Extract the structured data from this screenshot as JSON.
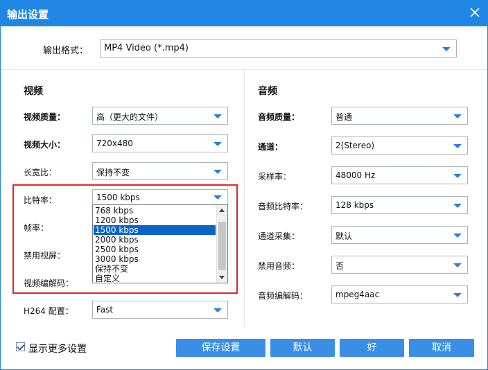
{
  "window": {
    "title": "输出设置",
    "close_icon": "close-icon"
  },
  "format": {
    "label": "输出格式：",
    "value": "MP4 Video (*.mp4)"
  },
  "video": {
    "heading": "视频",
    "quality": {
      "label": "视频质量：",
      "value": "高（更大的文件）"
    },
    "size": {
      "label": "视频大小：",
      "value": "720x480"
    },
    "aspect": {
      "label": "长宽比：",
      "value": "保持不变"
    },
    "bitrate": {
      "label": "比特率：",
      "value": "1500 kbps"
    },
    "framerate": {
      "label": "帧率："
    },
    "disable_video": {
      "label": "禁用视屏："
    },
    "codec": {
      "label": "视频编解码："
    },
    "h264": {
      "label": "H264 配置：",
      "value": "Fast"
    }
  },
  "bitrate_dropdown": {
    "options": [
      "768 kbps",
      "1200 kbps",
      "1500 kbps",
      "2000 kbps",
      "2500 kbps",
      "3000 kbps",
      "保持不变",
      "自定义"
    ],
    "selected": "1500 kbps"
  },
  "audio": {
    "heading": "音频",
    "quality": {
      "label": "音频质量：",
      "value": "普通"
    },
    "channel": {
      "label": "通道：",
      "value": "2(Stereo)"
    },
    "samplerate": {
      "label": "采样率：",
      "value": "48000 Hz"
    },
    "bitrate": {
      "label": "音频比特率：",
      "value": "128 kbps"
    },
    "channel_sampling": {
      "label": "通道采集：",
      "value": "默认"
    },
    "disable_audio": {
      "label": "禁用音频：",
      "value": "否"
    },
    "codec": {
      "label": "音频编解码：",
      "value": "mpeg4aac"
    }
  },
  "footer": {
    "more_settings": "显示更多设置",
    "more_settings_checked": true,
    "save_settings": "保存设置",
    "default": "默认",
    "ok": "好",
    "cancel": "取消"
  },
  "colors": {
    "titlebar": "#1f87e3",
    "button": "#3a8ee6",
    "selection": "#0a64c8",
    "highlight_box": "#e0262b"
  }
}
